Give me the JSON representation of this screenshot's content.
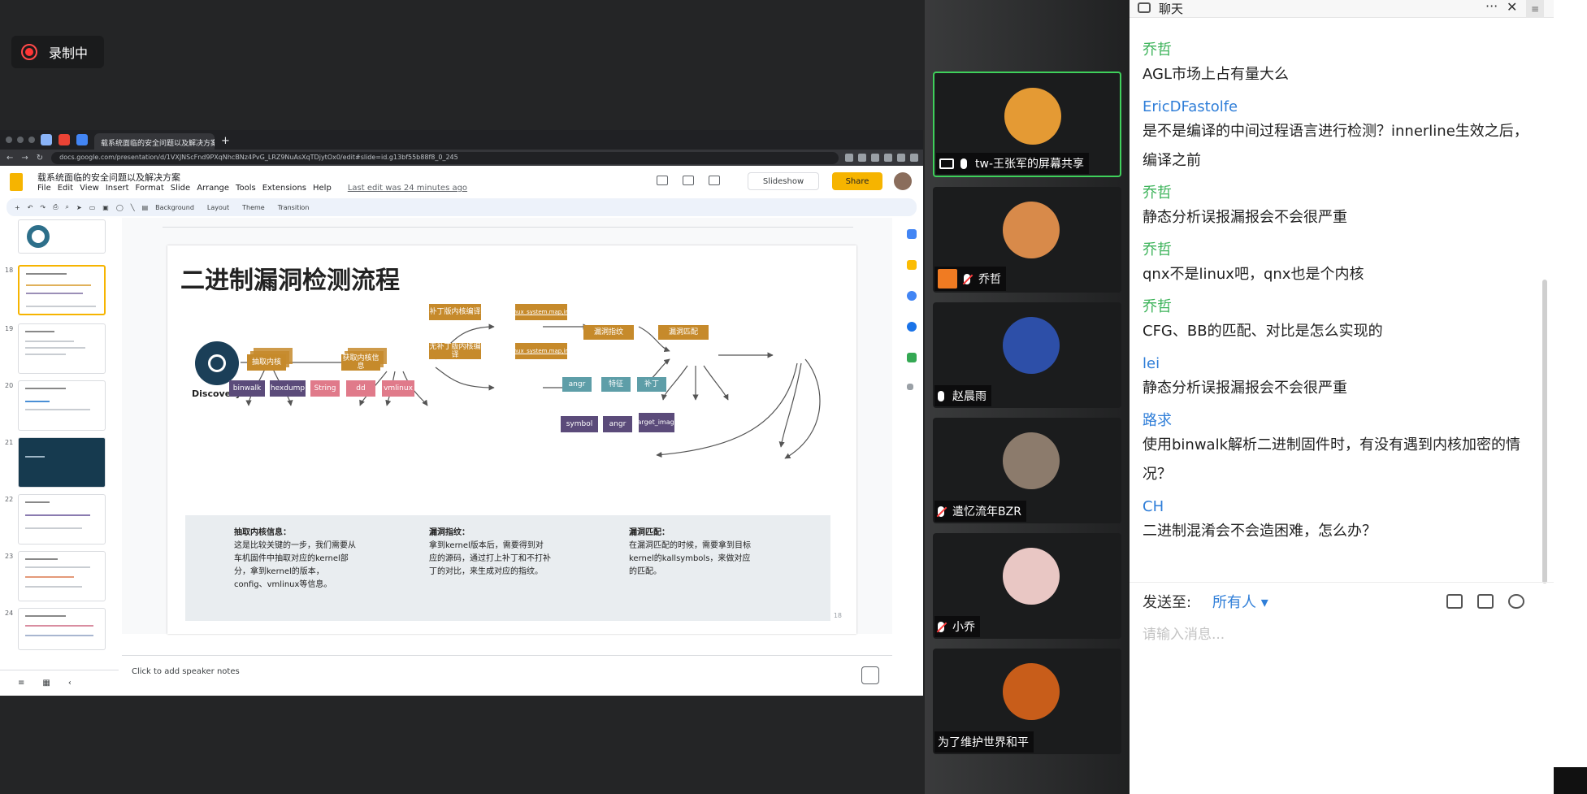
{
  "recording": {
    "label": "录制中"
  },
  "browser": {
    "tab_title": "载系统面临的安全问题以及解决方案",
    "new_tab": "+",
    "url": "docs.google.com/presentation/d/1VXJNScFnd9PXqNhcBNz4PvG_LRZ9NuAsXqTDjytOx0/edit#slide=id.g13bf55b88f8_0_245"
  },
  "slides_app": {
    "doc_title": "载系统面临的安全问题以及解决方案",
    "menu": [
      "File",
      "Edit",
      "View",
      "Insert",
      "Format",
      "Slide",
      "Arrange",
      "Tools",
      "Extensions",
      "Help"
    ],
    "last_edit": "Last edit was 24 minutes ago",
    "slideshow_label": "Slideshow",
    "share_label": "Share",
    "toolbar": {
      "background": "Background",
      "layout": "Layout",
      "theme": "Theme",
      "transition": "Transition"
    },
    "speaker_notes_placeholder": "Click to add speaker notes",
    "thumb_numbers": [
      "18",
      "19",
      "20",
      "21",
      "22",
      "23",
      "24"
    ]
  },
  "slide": {
    "title": "二进制漏洞检测流程",
    "discovery_label": "Discovery",
    "nodes": {
      "extract_kernel": "抽取内核",
      "get_kernel_info": "获取内核信息",
      "patched_kernel": "补丁版内核编译",
      "unpatched_kernel": "无补丁版内核编译",
      "vmlinux_system_top": "vmlinux_system.map,image",
      "vmlinux_system_bottom": "vmlinux_system.map,image",
      "vuln_fingerprint": "漏洞指纹",
      "vuln_match": "漏洞匹配",
      "binwalk": "binwalk",
      "hexdump": "hexdump",
      "string": "String",
      "dd": "dd",
      "vmlinux": "vmlinux",
      "angr_top": "angr",
      "feature": "特征",
      "patch": "补丁",
      "symbol": "symbol",
      "angr_bottom": "angr",
      "target_image": "target_image"
    },
    "notes": [
      {
        "heading": "抽取内核信息：",
        "body": "这是比较关键的一步，我们需要从车机固件中抽取对应的kernel部分，拿到kernel的版本，config、vmlinux等信息。"
      },
      {
        "heading": "漏洞指纹：",
        "body": "拿到kernel版本后，需要得到对应的源码，通过打上补丁和不打补丁的对比，来生成对应的指纹。"
      },
      {
        "heading": "漏洞匹配：",
        "body": "在漏洞匹配的时候，需要拿到目标kernel的kallsymbols，来做对应的匹配。"
      }
    ],
    "slide_number": "18"
  },
  "gallery": [
    {
      "name": "tw-王张军的屏幕共享",
      "color": "#e49a34"
    },
    {
      "name": "乔哲",
      "color": "#d88a4a"
    },
    {
      "name": "赵晨雨",
      "color": "#2d4fa8"
    },
    {
      "name": "遣忆流年BZR",
      "color": "#8c7b6c"
    },
    {
      "name": "小乔",
      "color": "#e9c7c4"
    },
    {
      "name": "为了维护世界和平",
      "color": "#c85d1a"
    }
  ],
  "chat": {
    "title": "聊天",
    "messages": [
      {
        "sender": "乔哲",
        "text": "AGL市场上占有量大么",
        "color": "green"
      },
      {
        "sender": "EricDFastolfe",
        "text": "是不是编译的中间过程语言进行检测？innerline生效之后，编译之前",
        "color": "blue"
      },
      {
        "sender": "乔哲",
        "text": "静态分析误报漏报会不会很严重",
        "color": "green"
      },
      {
        "sender": "乔哲",
        "text": " qnx不是linux吧，qnx也是个内核",
        "color": "green"
      },
      {
        "sender": "乔哲",
        "text": "CFG、BB的匹配、对比是怎么实现的",
        "color": "green"
      },
      {
        "sender": "lei",
        "text": "静态分析误报漏报会不会很严重",
        "color": "blue"
      },
      {
        "sender": "路求",
        "text": "使用binwalk解析二进制固件时，有没有遇到内核加密的情况？",
        "color": "blue"
      },
      {
        "sender": "CH",
        "text": "二进制混淆会不会造困难，怎么办？",
        "color": "blue"
      }
    ],
    "send_to_label": "发送至:",
    "recipient": "所有人 ▾",
    "input_placeholder": "请输入消息..."
  }
}
